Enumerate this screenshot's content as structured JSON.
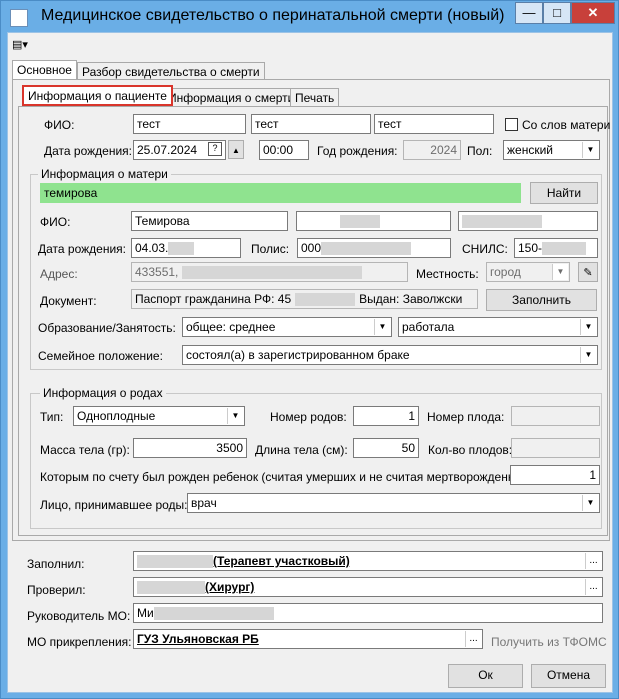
{
  "window": {
    "title": "Медицинское свидетельство о перинатальной смерти (новый)",
    "min": "—",
    "max": "□",
    "close": "✕"
  },
  "tabs": {
    "main": "Основное",
    "analysis": "Разбор свидетельства о смерти"
  },
  "subtabs": {
    "patient": "Информация о пациенте",
    "death": "Информация о смерти",
    "print": "Печать"
  },
  "patient": {
    "fio_label": "ФИО:",
    "last": "тест",
    "first": "тест",
    "middle": "тест",
    "mother_words": "Со слов матери",
    "birth_label": "Дата рождения:",
    "birth_date": "25.07.2024",
    "birth_time": "00:00",
    "year_label": "Год рождения:",
    "year": "2024",
    "sex_label": "Пол:",
    "sex": "женский"
  },
  "mother": {
    "group": "Информация о матери",
    "search": "темирова",
    "find": "Найти",
    "fio_label": "ФИО:",
    "last": "Темирова",
    "birth_label": "Дата рождения:",
    "birth": "04.03.",
    "policy_label": "Полис:",
    "policy": "000",
    "snils_label": "СНИЛС:",
    "snils": "150-",
    "addr_label": "Адрес:",
    "addr": "433551,",
    "locality_label": "Местность:",
    "locality": "город",
    "doc_label": "Документ:",
    "doc": "Паспорт гражданина РФ: 45",
    "doc2": "Выдан: Заволжски",
    "fill": "Заполнить",
    "edu_label": "Образование/Занятость:",
    "edu": "общее: среднее",
    "work": "работала",
    "family_label": "Семейное положение:",
    "family": "состоял(а) в зарегистрированном браке"
  },
  "birth": {
    "group": "Информация о родах",
    "type_label": "Тип:",
    "type": "Одноплодные",
    "num_label": "Номер родов:",
    "num": "1",
    "fetus_label": "Номер плода:",
    "mass_label": "Масса тела (гр):",
    "mass": "3500",
    "len_label": "Длина тела (см):",
    "len": "50",
    "count_label": "Кол-во плодов:",
    "order_label": "Которым по счету был рожден ребенок (считая умерших и не считая мертворожденных):",
    "order": "1",
    "person_label": "Лицо, принимавшее роды:",
    "person": "врач"
  },
  "footer": {
    "filled_label": "Заполнил:",
    "filled": "(Терапевт участковый)",
    "checked_label": "Проверил:",
    "checked": "(Хирург)",
    "head_label": "Руководитель МО:",
    "head": "Ми",
    "mo_label": "МО прикрепления:",
    "mo": "ГУЗ Ульяновская РБ",
    "tfoms": "Получить из ТФОМС",
    "dots": "...",
    "ok": "Ок",
    "cancel": "Отмена"
  }
}
